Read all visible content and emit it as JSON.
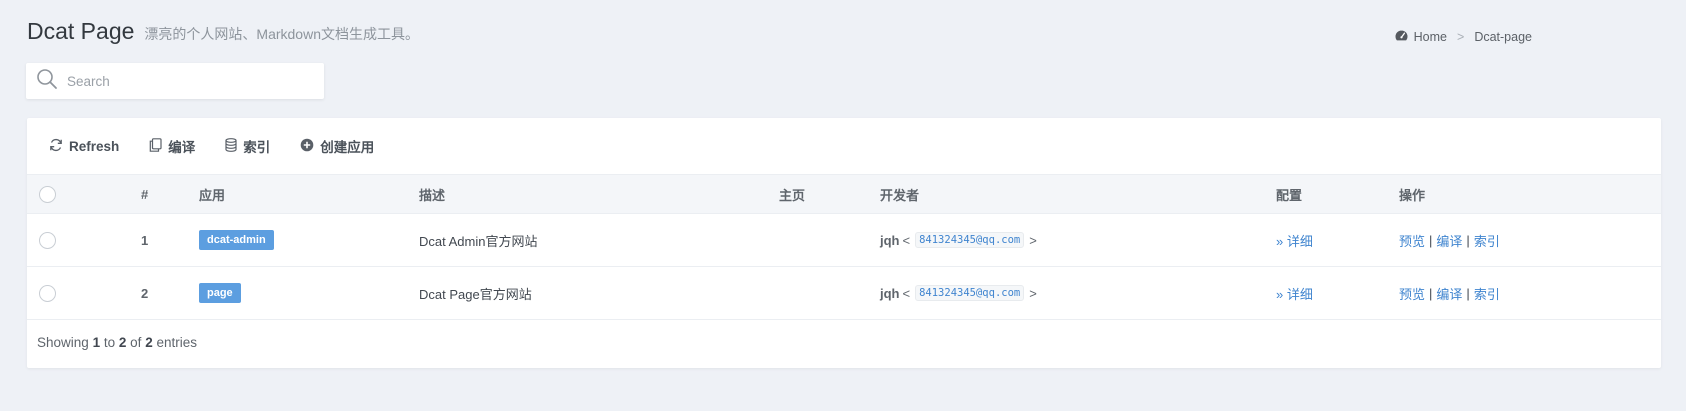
{
  "header": {
    "title": "Dcat Page",
    "subtitle": "漂亮的个人网站、Markdown文档生成工具。"
  },
  "breadcrumb": {
    "home": "Home",
    "separator": ">",
    "current": "Dcat-page"
  },
  "search": {
    "placeholder": "Search",
    "value": ""
  },
  "toolbar": {
    "refresh": "Refresh",
    "compile": "编译",
    "index": "索引",
    "create": "创建应用"
  },
  "table": {
    "columns": {
      "num": "#",
      "app": "应用",
      "desc": "描述",
      "home": "主页",
      "dev": "开发者",
      "config": "配置",
      "actions": "操作"
    },
    "rows": [
      {
        "id": "1",
        "app": "dcat-admin",
        "desc": "Dcat Admin官方网站",
        "home": "",
        "dev_name": "jqh",
        "dev_email": "841324345@qq.com",
        "config": "» 详细",
        "preview": "预览",
        "compile": "编译",
        "index": "索引"
      },
      {
        "id": "2",
        "app": "page",
        "desc": "Dcat Page官方网站",
        "home": "",
        "dev_name": "jqh",
        "dev_email": "841324345@qq.com",
        "config": "» 详细",
        "preview": "预览",
        "compile": "编译",
        "index": "索引"
      }
    ]
  },
  "footer": {
    "showing": "Showing",
    "from": "1",
    "to_word": "to",
    "to": "2",
    "of_word": "of",
    "total": "2",
    "entries": "entries"
  },
  "colors": {
    "background": "#eef1f6",
    "tag": "#5c9ee0",
    "link": "#3f84cf"
  },
  "icons": {
    "breadcrumb": "dashboard-gauge-icon",
    "search": "search-icon",
    "refresh": "refresh-icon",
    "compile": "file-copy-icon",
    "index": "database-icon",
    "create": "plus-circle-icon"
  }
}
